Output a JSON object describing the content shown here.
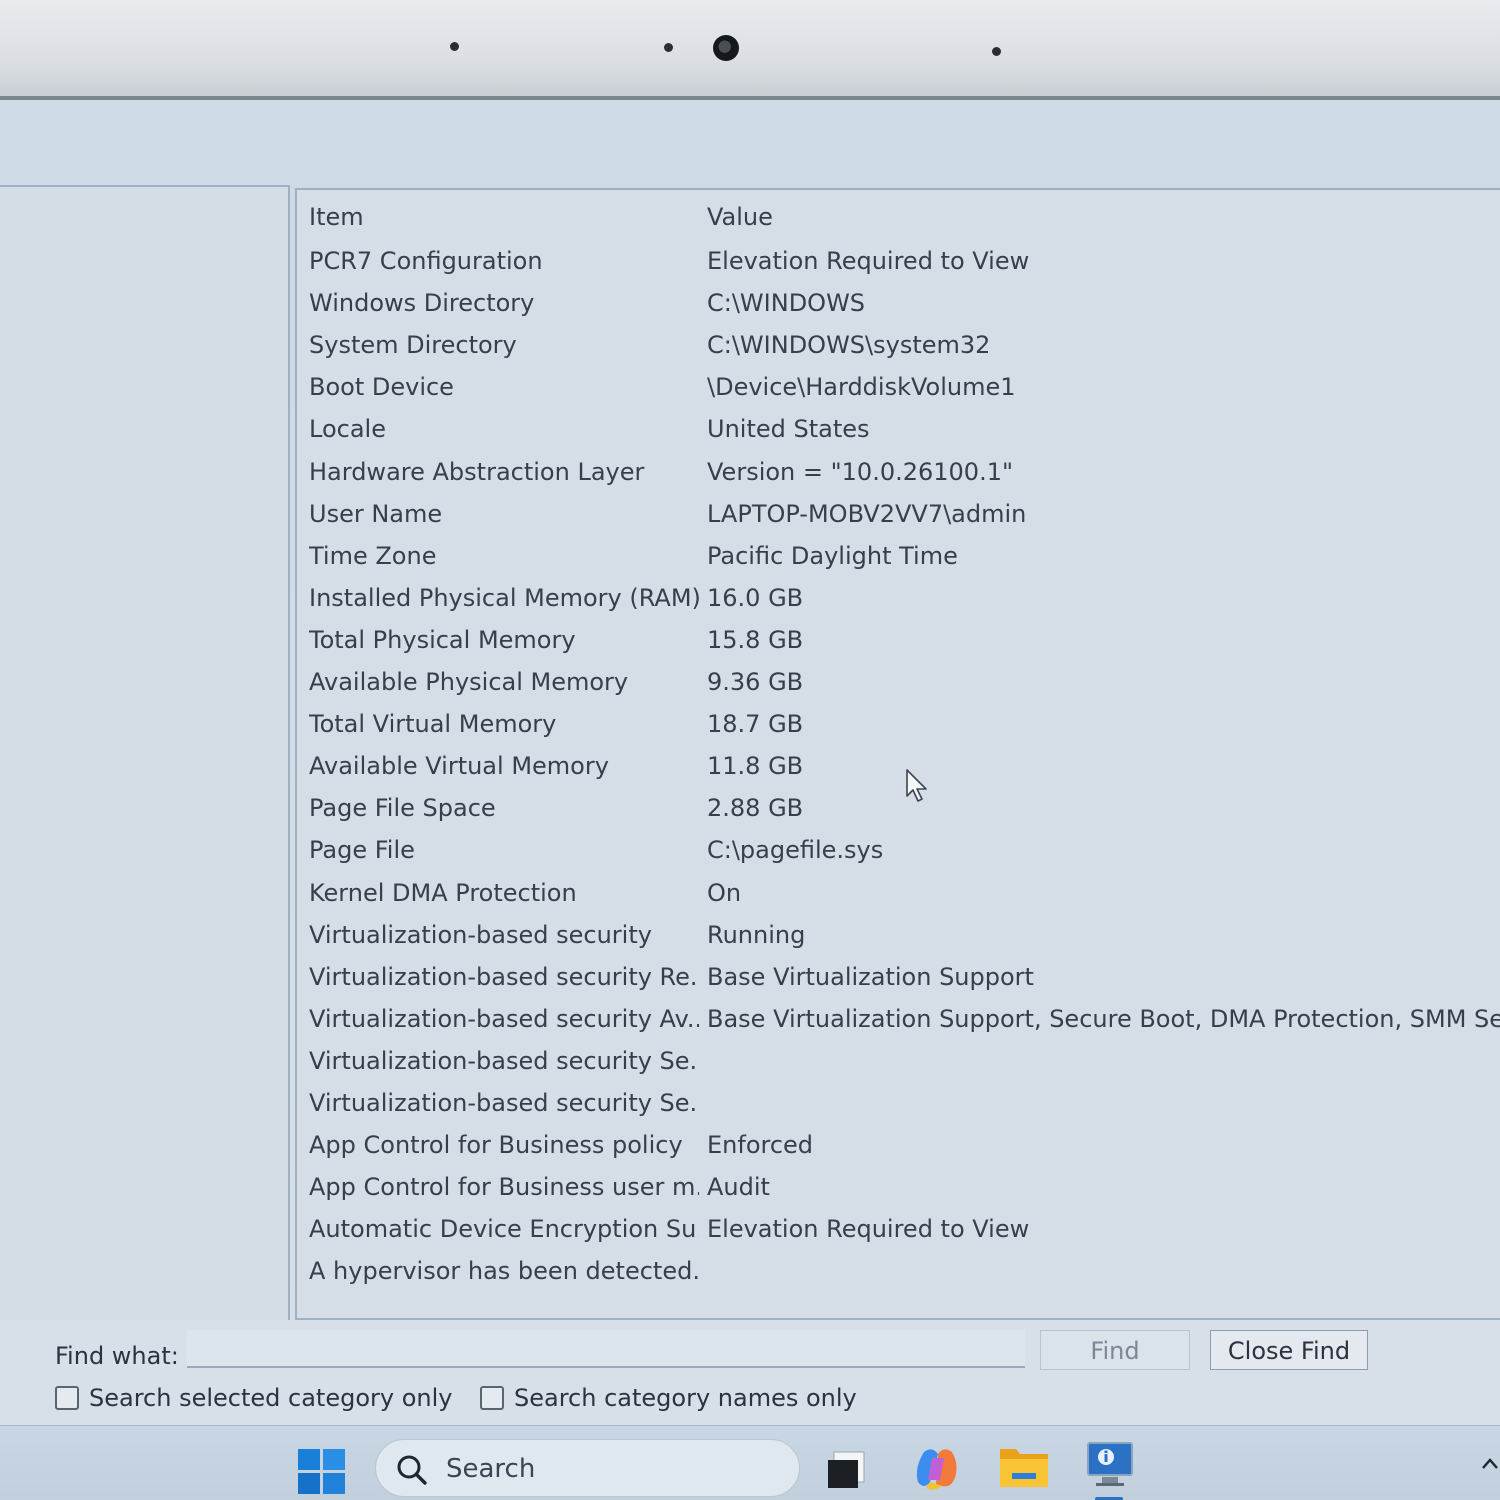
{
  "list": {
    "header": {
      "item": "Item",
      "value": "Value"
    },
    "rows": [
      {
        "item": "PCR7 Configuration",
        "value": "Elevation Required to View"
      },
      {
        "item": "Windows Directory",
        "value": "C:\\WINDOWS"
      },
      {
        "item": "System Directory",
        "value": "C:\\WINDOWS\\system32"
      },
      {
        "item": "Boot Device",
        "value": "\\Device\\HarddiskVolume1"
      },
      {
        "item": "Locale",
        "value": "United States"
      },
      {
        "item": "Hardware Abstraction Layer",
        "value": "Version = \"10.0.26100.1\""
      },
      {
        "item": "User Name",
        "value": "LAPTOP-MOBV2VV7\\admin"
      },
      {
        "item": "Time Zone",
        "value": "Pacific Daylight Time"
      },
      {
        "item": "Installed Physical Memory (RAM)",
        "value": "16.0 GB"
      },
      {
        "item": "Total Physical Memory",
        "value": "15.8 GB"
      },
      {
        "item": "Available Physical Memory",
        "value": "9.36 GB"
      },
      {
        "item": "Total Virtual Memory",
        "value": "18.7 GB"
      },
      {
        "item": "Available Virtual Memory",
        "value": "11.8 GB"
      },
      {
        "item": "Page File Space",
        "value": "2.88 GB"
      },
      {
        "item": "Page File",
        "value": "C:\\pagefile.sys"
      },
      {
        "item": "Kernel DMA Protection",
        "value": "On"
      },
      {
        "item": "Virtualization-based security",
        "value": "Running"
      },
      {
        "item": "Virtualization-based security Re...",
        "value": "Base Virtualization Support"
      },
      {
        "item": "Virtualization-based security Av...",
        "value": "Base Virtualization Support, Secure Boot, DMA Protection, SMM Securi"
      },
      {
        "item": "Virtualization-based security Se...",
        "value": ""
      },
      {
        "item": "Virtualization-based security Se...",
        "value": ""
      },
      {
        "item": "App Control for Business policy",
        "value": "Enforced"
      },
      {
        "item": "App Control for Business user m...",
        "value": "Audit"
      },
      {
        "item": "Automatic Device Encryption Su...",
        "value": "Elevation Required to View"
      },
      {
        "item": "A hypervisor has been detected....",
        "value": ""
      }
    ]
  },
  "findbar": {
    "find_what_label": "Find what:",
    "find_input_value": "",
    "find_button": "Find",
    "close_find_button": "Close Find",
    "search_selected_category_only": "Search selected category only",
    "search_category_names_only": "Search category names only"
  },
  "taskbar": {
    "search_label": "Search",
    "icons": [
      "windows-start-icon",
      "search-icon",
      "task-view-icon",
      "copilot-icon",
      "file-explorer-icon",
      "system-information-icon",
      "chevron-up-icon"
    ]
  }
}
